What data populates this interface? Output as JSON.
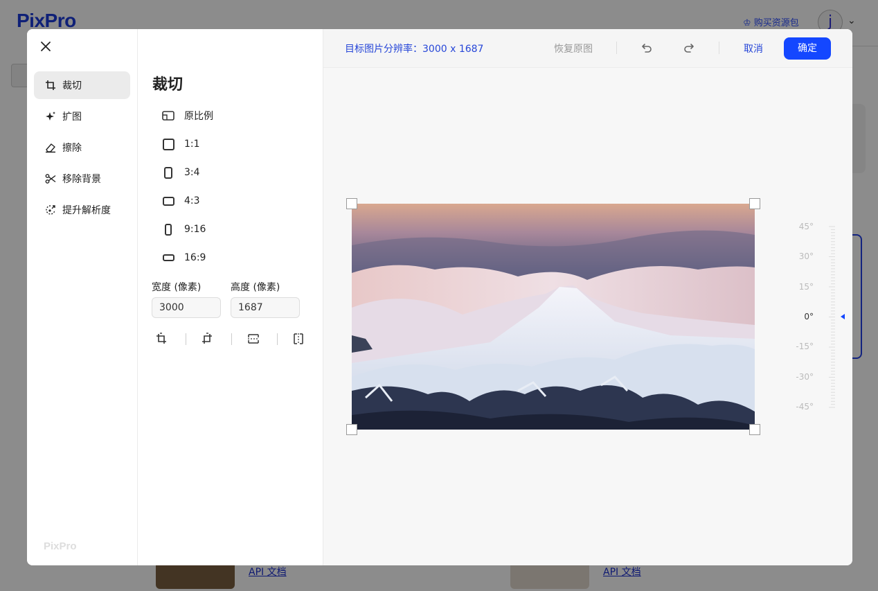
{
  "background": {
    "logo": "PixPro",
    "buy_pack": "购买资源包",
    "avatar_letter": "j",
    "api_doc_left": "API 文档",
    "api_doc_right": "API 文档"
  },
  "nav": {
    "items": [
      {
        "label": "裁切",
        "icon": "crop-icon",
        "active": true
      },
      {
        "label": "扩图",
        "icon": "sparkle-icon",
        "active": false
      },
      {
        "label": "擦除",
        "icon": "eraser-icon",
        "active": false
      },
      {
        "label": "移除背景",
        "icon": "scissors-icon",
        "active": false
      },
      {
        "label": "提升解析度",
        "icon": "upscale-icon",
        "active": false
      }
    ],
    "footer_logo": "PixPro"
  },
  "panel": {
    "title": "裁切",
    "ratios": [
      {
        "label": "原比例",
        "icon": "original-ratio-icon"
      },
      {
        "label": "1:1",
        "icon": "square-ratio-icon"
      },
      {
        "label": "3:4",
        "icon": "portrait-3-4-icon"
      },
      {
        "label": "4:3",
        "icon": "landscape-4-3-icon"
      },
      {
        "label": "9:16",
        "icon": "portrait-9-16-icon"
      },
      {
        "label": "16:9",
        "icon": "landscape-16-9-icon"
      }
    ],
    "width_label": "宽度 (像素)",
    "height_label": "高度 (像素)",
    "width_value": "3000",
    "height_value": "1687",
    "tools": [
      "rotate-left-icon",
      "rotate-right-icon",
      "flip-vertical-icon",
      "flip-horizontal-icon"
    ]
  },
  "topbar": {
    "resolution_label": "目标图片分辨率：3000 x 1687",
    "restore_label": "恢复原图",
    "cancel_label": "取消",
    "confirm_label": "确定"
  },
  "rotation_ruler": {
    "labels": [
      "45°",
      "30°",
      "15°",
      "0°",
      "-15°",
      "-30°",
      "-45°"
    ],
    "current_angle": 0
  },
  "colors": {
    "accent": "#1447ff",
    "link": "#2646d8",
    "brand": "#1d3bd9"
  }
}
